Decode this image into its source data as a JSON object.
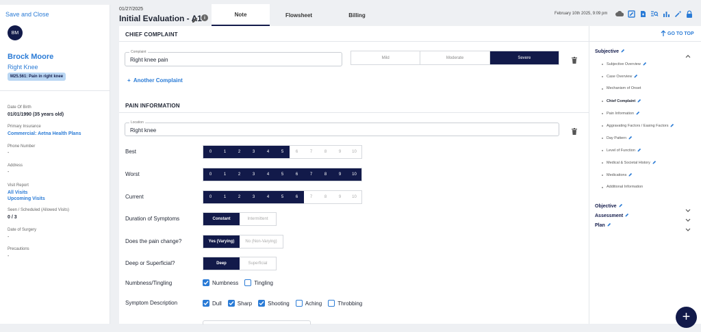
{
  "left": {
    "save_close": "Save and Close",
    "avatar": "BM",
    "patient_name": "Brock Moore",
    "case_name": "Right Knee",
    "dx_badge": "M25.561: Pain in right knee",
    "dob_label": "Date Of Birth",
    "dob_value": "01/01/1990 (35 years old)",
    "insurance_label": "Primary Insurance",
    "insurance_value": "Commercial: Aetna Health Plans",
    "phone_label": "Phone Number",
    "phone_value": "-",
    "address_label": "Address",
    "address_value": "-",
    "visit_report_label": "Visit Report",
    "all_visits": "All Visits",
    "upcoming_visits": "Upcoming Visits",
    "seen_label": "Seen / Scheduled (Allowed Visits)",
    "seen_value": "0 / 3",
    "surgery_label": "Date of Surgery",
    "surgery_value": "-",
    "precautions_label": "Precautions",
    "precautions_value": "-"
  },
  "header": {
    "date": "01/27/2025",
    "title": "Initial Evaluation - A1",
    "tabs": [
      "Note",
      "Flowsheet",
      "Billing"
    ],
    "timestamp": "February 10th 2025, 9:09 pm"
  },
  "chief_complaint": {
    "heading": "CHIEF COMPLAINT",
    "complaint_label": "Complaint",
    "complaint_value": "Right knee pain",
    "severity": [
      "Mild",
      "Moderate",
      "Severe"
    ],
    "severity_selected": "Severe",
    "another": "Another Complaint"
  },
  "pain": {
    "heading": "PAIN INFORMATION",
    "location_label": "Location",
    "location_value": "Right knee",
    "scale": [
      "0",
      "1",
      "2",
      "3",
      "4",
      "5",
      "6",
      "7",
      "8",
      "9",
      "10"
    ],
    "best_label": "Best",
    "best_value": 5,
    "worst_label": "Worst",
    "worst_value": 10,
    "current_label": "Current",
    "current_value": 6,
    "duration_label": "Duration of Symptoms",
    "duration_options": [
      "Constant",
      "Intermittent"
    ],
    "duration_selected": "Constant",
    "change_label": "Does the pain change?",
    "change_options": [
      "Yes (Varying)",
      "No (Non-Varying)"
    ],
    "change_selected": "Yes (Varying)",
    "depth_label": "Deep or Superficial?",
    "depth_options": [
      "Deep",
      "Superficial"
    ],
    "depth_selected": "Deep",
    "numbness_label": "Numbness/Tingling",
    "numbness_options": [
      {
        "label": "Numbness",
        "checked": true
      },
      {
        "label": "Tingling",
        "checked": false
      }
    ],
    "symptom_label": "Symptom Description",
    "symptom_options": [
      {
        "label": "Dull",
        "checked": true
      },
      {
        "label": "Sharp",
        "checked": true
      },
      {
        "label": "Shooting",
        "checked": true
      },
      {
        "label": "Aching",
        "checked": false
      },
      {
        "label": "Throbbing",
        "checked": false
      }
    ]
  },
  "outline": {
    "go_to_top": "GO TO TOP",
    "subjective": "Subjective",
    "subjective_items": [
      {
        "label": "Subjective Overview",
        "edited": true,
        "current": false
      },
      {
        "label": "Case Overview",
        "edited": true,
        "current": false
      },
      {
        "label": "Mechanism of Onset",
        "edited": false,
        "current": false
      },
      {
        "label": "Chief Complaint",
        "edited": true,
        "current": true
      },
      {
        "label": "Pain Information",
        "edited": true,
        "current": false
      },
      {
        "label": "Aggravating Factors / Easing Factors",
        "edited": true,
        "current": false
      },
      {
        "label": "Day Pattern",
        "edited": true,
        "current": false
      },
      {
        "label": "Level of Function",
        "edited": true,
        "current": false
      },
      {
        "label": "Medical & Societal History",
        "edited": true,
        "current": false
      },
      {
        "label": "Medications",
        "edited": true,
        "current": false
      },
      {
        "label": "Additional Information",
        "edited": false,
        "current": false
      }
    ],
    "objective": "Objective",
    "assessment": "Assessment",
    "plan": "Plan"
  },
  "colors": {
    "navy": "#121a4a",
    "accent": "#2a7bd6"
  },
  "icons": [
    "cloud-icon",
    "edit-note-icon",
    "add-document-icon",
    "search-list-icon",
    "chart-icon",
    "magic-wand-icon",
    "lock-icon",
    "trash-icon",
    "pencil-icon",
    "info-icon",
    "plus-icon",
    "arrow-up-icon",
    "chevron-up-icon",
    "chevron-down-icon"
  ]
}
